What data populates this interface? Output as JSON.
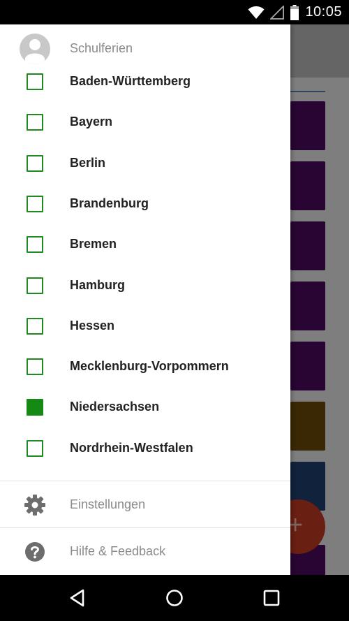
{
  "status_bar": {
    "time": "10:05",
    "icons": [
      "wifi-icon",
      "signal-icon",
      "battery-icon"
    ]
  },
  "drawer": {
    "title": "Schulferien",
    "states": [
      {
        "label": "Baden-Württemberg",
        "checked": false
      },
      {
        "label": "Bayern",
        "checked": false
      },
      {
        "label": "Berlin",
        "checked": false
      },
      {
        "label": "Brandenburg",
        "checked": false
      },
      {
        "label": "Bremen",
        "checked": false
      },
      {
        "label": "Hamburg",
        "checked": false
      },
      {
        "label": "Hessen",
        "checked": false
      },
      {
        "label": "Mecklenburg-Vorpommern",
        "checked": false
      },
      {
        "label": "Niedersachsen",
        "checked": true
      },
      {
        "label": "Nordrhein-Westfalen",
        "checked": false
      }
    ],
    "menu": [
      {
        "label": "Einstellungen",
        "icon": "gear-icon"
      },
      {
        "label": "Hilfe & Feedback",
        "icon": "help-icon"
      }
    ]
  },
  "background": {
    "card_colors": [
      "#4a0a5e",
      "#4a0a5e",
      "#4a0a5e",
      "#4a0a5e",
      "#4a0a5e",
      "#6b4a0a",
      "#1e3e6e",
      "#4a0a5e"
    ],
    "fab_label": "+",
    "accent": "#148a14"
  },
  "nav_bar": {
    "buttons": [
      "back-icon",
      "home-icon",
      "recents-icon"
    ]
  }
}
